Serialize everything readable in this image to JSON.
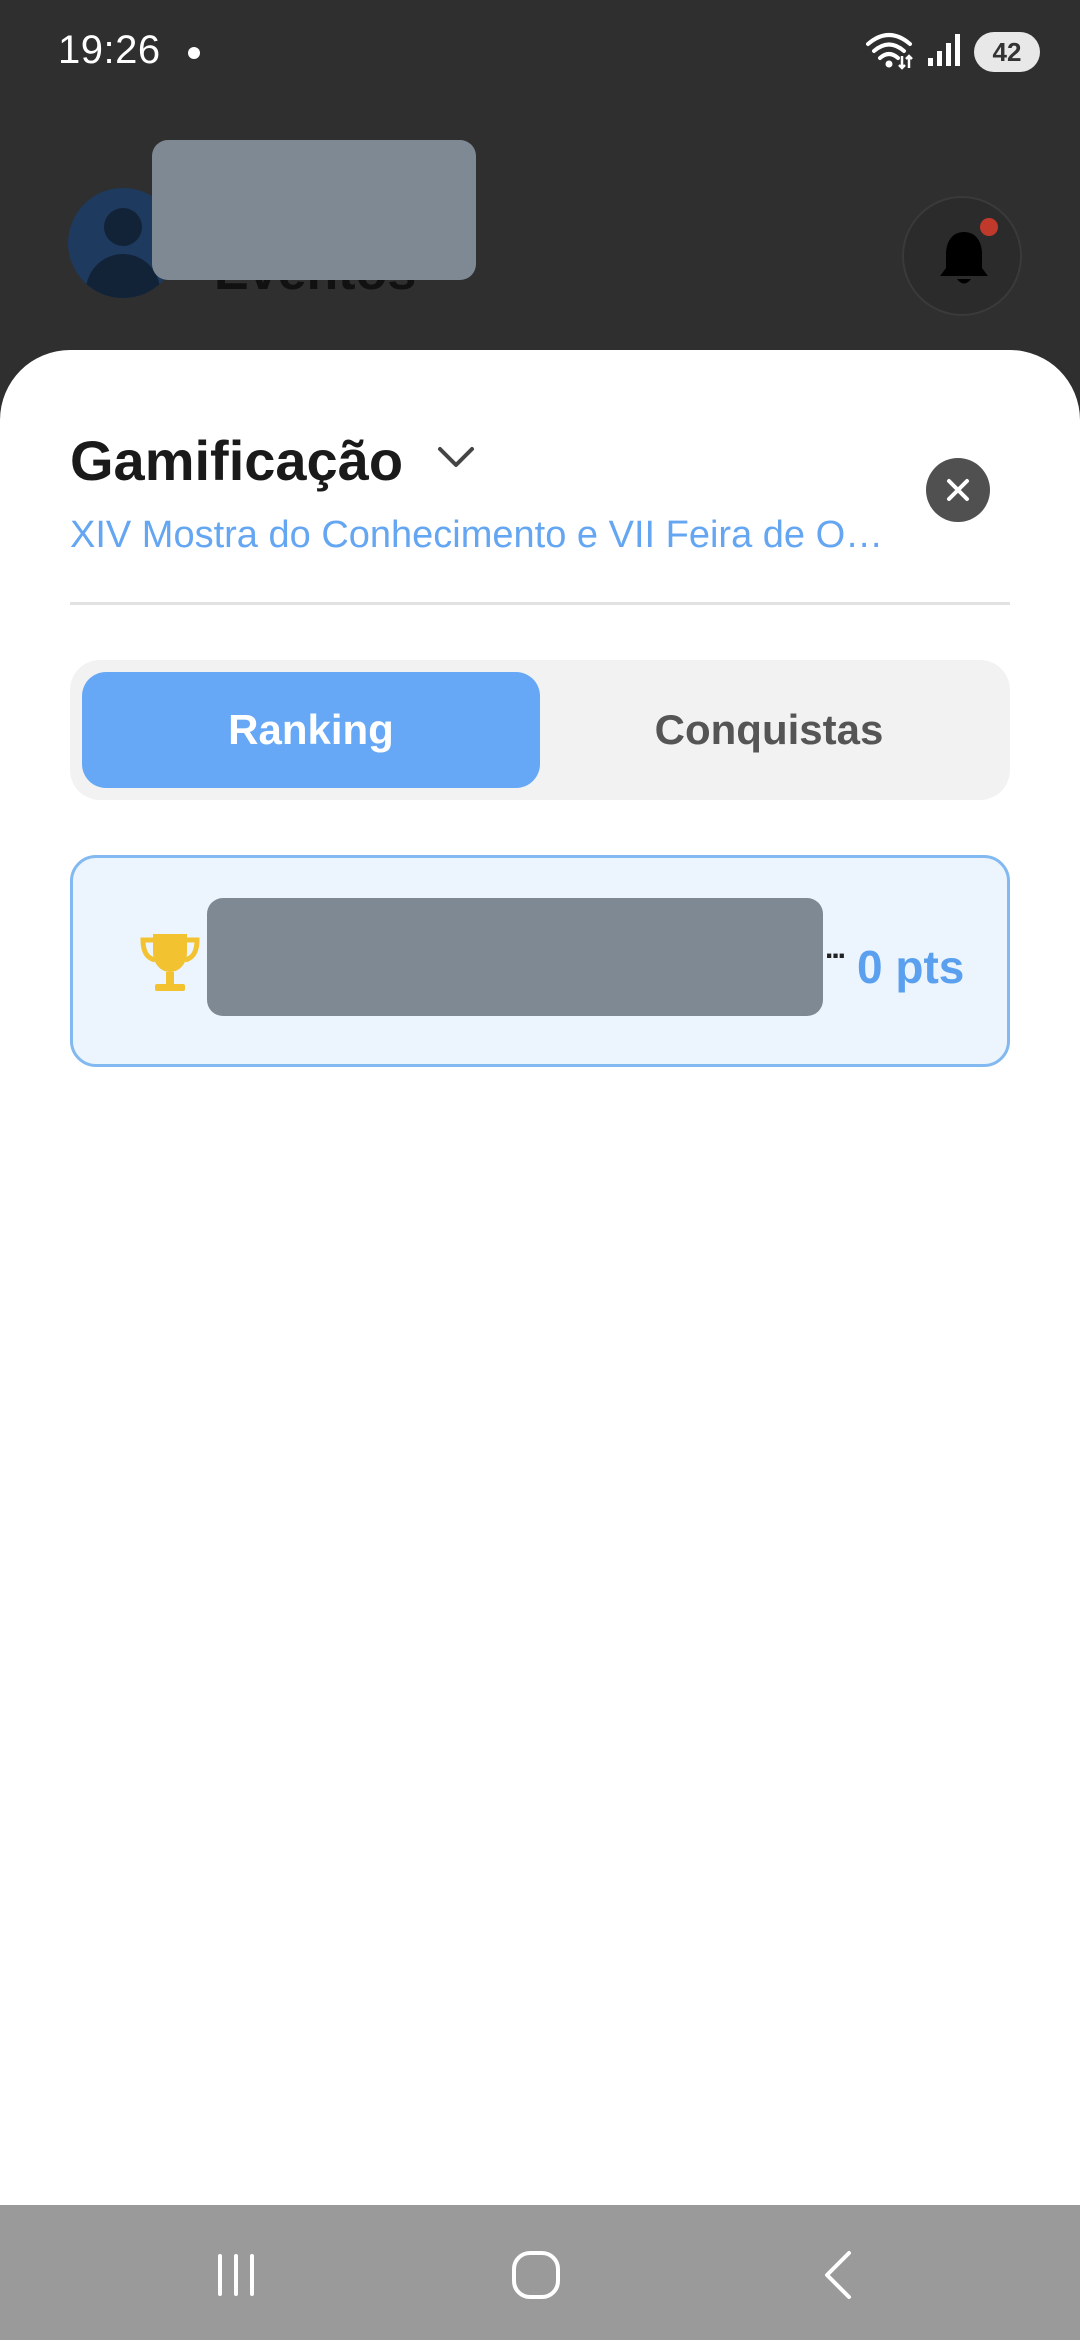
{
  "status_bar": {
    "time": "19:26",
    "battery": "42"
  },
  "background_header": {
    "title": "Eventos"
  },
  "sheet": {
    "title": "Gamificação",
    "subtitle": "XIV Mostra do Conhecimento e VII Feira de Op...",
    "tabs": [
      {
        "label": "Ranking",
        "active": true
      },
      {
        "label": "Conquistas",
        "active": false
      }
    ],
    "ranking": [
      {
        "ellipsis": "...",
        "points": "0 pts"
      }
    ]
  },
  "colors": {
    "accent": "#66a8f5",
    "link": "#64a6f2",
    "trophy": "#f2c230",
    "card_bg": "#ecf5fd"
  },
  "icons": [
    "wifi-icon",
    "signal-icon",
    "bell-icon",
    "chevron-down-icon",
    "close-icon",
    "trophy-icon",
    "recent-apps-icon",
    "home-icon",
    "back-icon"
  ]
}
